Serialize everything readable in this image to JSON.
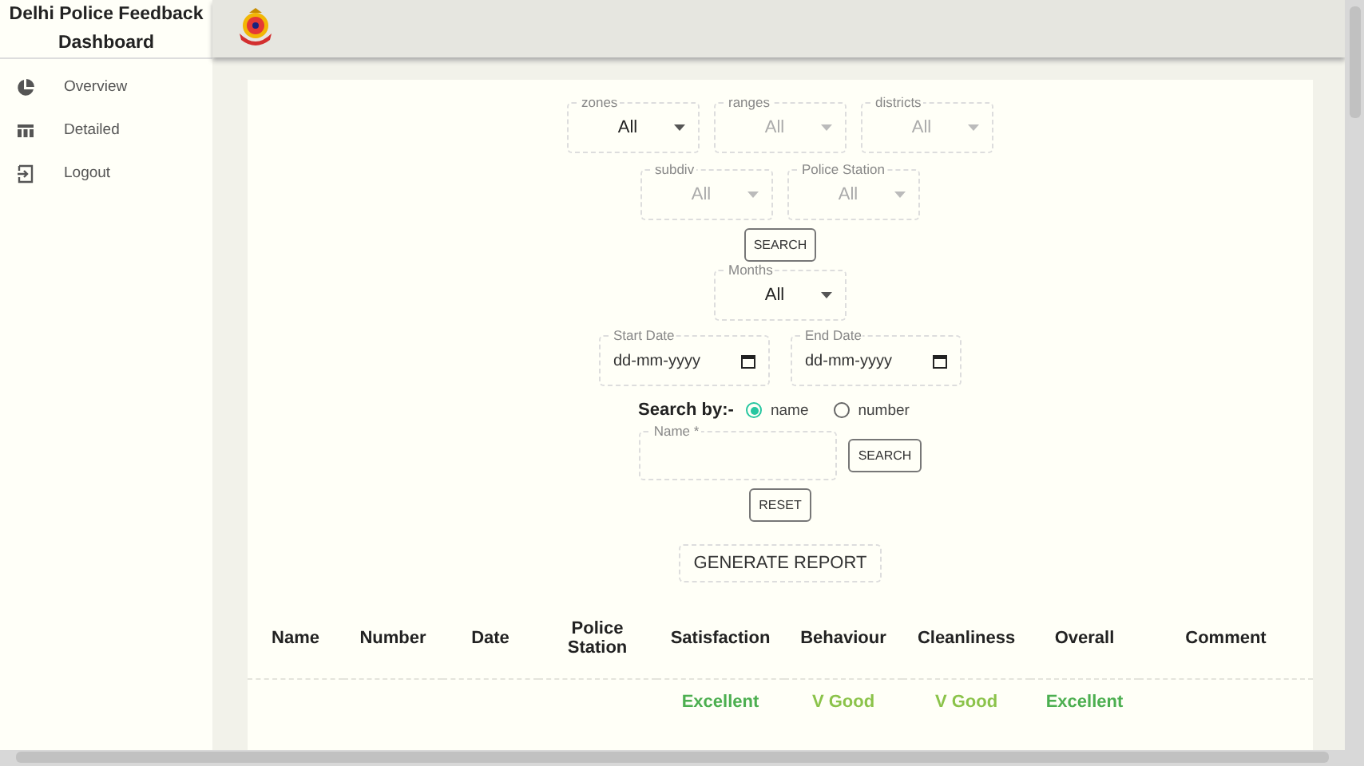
{
  "sidebar": {
    "title": "Delhi Police Feedback Dashboard",
    "items": [
      {
        "label": "Overview"
      },
      {
        "label": "Detailed"
      },
      {
        "label": "Logout"
      }
    ]
  },
  "filters": {
    "rows": [
      [
        {
          "label": "zones",
          "value": "All",
          "disabled": false
        },
        {
          "label": "ranges",
          "value": "All",
          "disabled": true
        },
        {
          "label": "districts",
          "value": "All",
          "disabled": true
        }
      ],
      [
        {
          "label": "subdiv",
          "value": "All",
          "disabled": true
        },
        {
          "label": "Police Station",
          "value": "All",
          "disabled": true
        }
      ]
    ],
    "search_button": "SEARCH",
    "months": {
      "label": "Months",
      "value": "All",
      "disabled": false
    },
    "start_date": {
      "label": "Start Date",
      "placeholder": "dd-mm-yyyy"
    },
    "end_date": {
      "label": "End Date",
      "placeholder": "dd-mm-yyyy"
    },
    "search_by": {
      "label": "Search by:-",
      "options": [
        {
          "label": "name",
          "selected": true
        },
        {
          "label": "number",
          "selected": false
        }
      ]
    },
    "name_field": {
      "label": "Name *"
    },
    "name_search_button": "SEARCH",
    "reset_button": "RESET",
    "generate_button": "GENERATE REPORT"
  },
  "table": {
    "columns": [
      "Name",
      "Number",
      "Date",
      "Police Station",
      "Satisfaction",
      "Behaviour",
      "Cleanliness",
      "Overall",
      "Comment"
    ],
    "rows": [
      [
        {
          "text": ""
        },
        {
          "text": ""
        },
        {
          "text": ""
        },
        {
          "text": ""
        },
        {
          "text": "Excellent",
          "color": "#4caf50"
        },
        {
          "text": "V Good",
          "color": "#8bc34a"
        },
        {
          "text": "V Good",
          "color": "#8bc34a"
        },
        {
          "text": "Excellent",
          "color": "#4caf50"
        },
        {
          "text": ""
        }
      ]
    ]
  }
}
